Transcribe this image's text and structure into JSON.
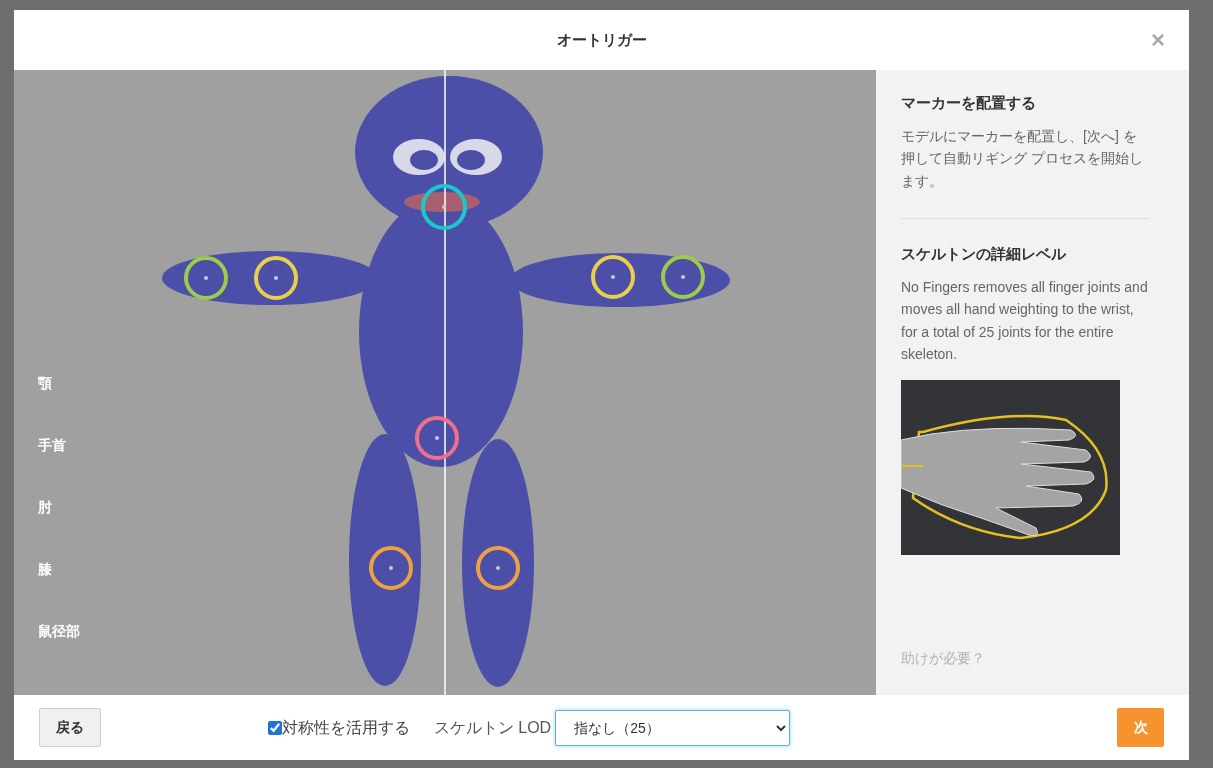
{
  "dialog": {
    "title": "オートリガー",
    "close": "×"
  },
  "viewport": {
    "joint_labels": [
      "顎",
      "手首",
      "肘",
      "膝",
      "鼠径部"
    ],
    "markers": [
      {
        "color": "#1ec8c8"
      },
      {
        "color": "#9ccc4a"
      },
      {
        "color": "#e8d04a"
      },
      {
        "color": "#e8d04a"
      },
      {
        "color": "#9ccc4a"
      },
      {
        "color": "#f07088"
      },
      {
        "color": "#f0a040"
      },
      {
        "color": "#f0a040"
      }
    ]
  },
  "side_panel": {
    "sections": [
      {
        "heading": "マーカーを配置する",
        "body": "モデルにマーカーを配置し、[次へ] を押して自動リギング プロセスを開始します。"
      },
      {
        "heading": "スケルトンの詳細レベル",
        "body": "No Fingers removes all finger joints and moves all hand weighting to the wrist, for a total of 25 joints for the entire skeleton."
      }
    ],
    "help_link": "助けが必要？"
  },
  "footer": {
    "back_button": "戻る",
    "symmetry": {
      "label": "対称性を活用する",
      "checked": true
    },
    "lod_label": "スケルトン LOD",
    "lod_value": "指なし（25）",
    "next_button": "次"
  }
}
